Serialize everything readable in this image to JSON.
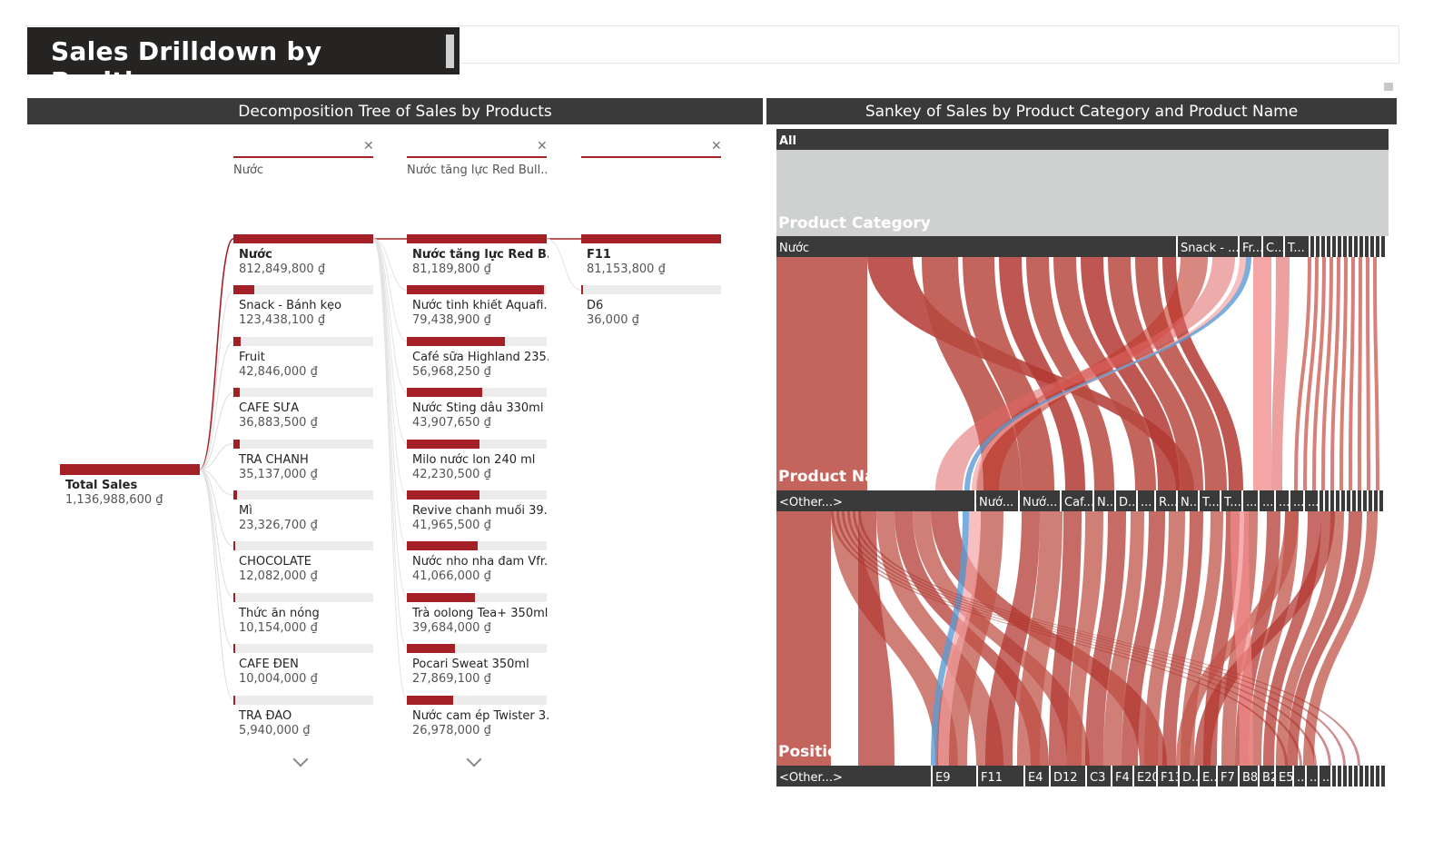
{
  "page": {
    "title": "Sales Drilldown by Positions"
  },
  "decomposition_tree": {
    "header": "Decomposition Tree of Sales by Products",
    "root": {
      "label": "Total Sales",
      "value": "1,136,988,600 ₫"
    },
    "filters": [
      {
        "crumb": "Nước",
        "close": "✕"
      },
      {
        "crumb": "Nước tăng lực Red Bull...",
        "close": "✕"
      },
      {
        "crumb": "",
        "close": "✕"
      }
    ],
    "levels": [
      [
        {
          "label": "Nước",
          "value": "812,849,800 ₫",
          "share": 1.0,
          "selected": true
        },
        {
          "label": "Snack - Bánh kẹo",
          "value": "123,438,100 ₫",
          "share": 0.152
        },
        {
          "label": "Fruit",
          "value": "42,846,000 ₫",
          "share": 0.053
        },
        {
          "label": "CAFE SỮA",
          "value": "36,883,500 ₫",
          "share": 0.045
        },
        {
          "label": "TRÀ CHANH",
          "value": "35,137,000 ₫",
          "share": 0.043
        },
        {
          "label": "Mì",
          "value": "23,326,700 ₫",
          "share": 0.029
        },
        {
          "label": "CHOCOLATE",
          "value": "12,082,000 ₫",
          "share": 0.015
        },
        {
          "label": "Thức ăn nóng",
          "value": "10,154,000 ₫",
          "share": 0.012
        },
        {
          "label": "CAFE ĐEN",
          "value": "10,004,000 ₫",
          "share": 0.012
        },
        {
          "label": "TRÀ ĐÀO",
          "value": "5,940,000 ₫",
          "share": 0.007
        }
      ],
      [
        {
          "label": "Nước tăng lực Red B...",
          "value": "81,189,800 ₫",
          "share": 1.0,
          "selected": true
        },
        {
          "label": "Nước tinh khiết Aquafi...",
          "value": "79,438,900 ₫",
          "share": 0.978
        },
        {
          "label": "Café sữa Highland 235...",
          "value": "56,968,250 ₫",
          "share": 0.702
        },
        {
          "label": "Nước Sting dâu 330ml",
          "value": "43,907,650 ₫",
          "share": 0.541
        },
        {
          "label": "Milo nước lon 240 ml",
          "value": "42,230,500 ₫",
          "share": 0.52
        },
        {
          "label": "Revive chanh muối 39...",
          "value": "41,965,500 ₫",
          "share": 0.517
        },
        {
          "label": "Nước nho nha đam Vfr...",
          "value": "41,066,000 ₫",
          "share": 0.506
        },
        {
          "label": "Trà oolong Tea+ 350ml",
          "value": "39,684,000 ₫",
          "share": 0.489
        },
        {
          "label": "Pocari Sweat 350ml",
          "value": "27,869,100 ₫",
          "share": 0.343
        },
        {
          "label": "Nước cam ép Twister 3...",
          "value": "26,978,000 ₫",
          "share": 0.332
        }
      ],
      [
        {
          "label": "F11",
          "value": "81,153,800 ₫",
          "share": 1.0,
          "selected": true
        },
        {
          "label": "D6",
          "value": "36,000 ₫",
          "share": 0.0004
        }
      ]
    ]
  },
  "sankey": {
    "header": "Sankey of Sales by Product Category and Product Name",
    "stages": [
      "Product Category",
      "Product Name",
      "Position"
    ],
    "all_label": "All",
    "category_nodes": [
      "Nước",
      "Snack - ...",
      "Fr...",
      "C...",
      "T..."
    ],
    "name_nodes": [
      "<Other...>",
      "Nướ...",
      "Nướ...",
      "Caf...",
      "N...",
      "D...",
      "...",
      "R...",
      "N...",
      "T...",
      "T...",
      "...",
      "...",
      "...",
      "...",
      "..."
    ],
    "position_nodes": [
      "<Other...>",
      "E9",
      "F11",
      "E4",
      "D12",
      "C3",
      "F4",
      "E20",
      "F13",
      "D...",
      "E...",
      "F7",
      "B8",
      "B2",
      "E5",
      "...",
      "...",
      "..."
    ]
  },
  "colors": {
    "accent": "#a32027",
    "header_bg": "#3a3a3a",
    "title_bg": "#252423",
    "sankey_band": "#c0392b",
    "sankey_highlight": "#5b9bd5",
    "sankey_grey": "#cfd0d0"
  },
  "chart_data": [
    {
      "type": "decomposition-tree",
      "title": "Decomposition Tree of Sales by Products",
      "root": {
        "name": "Total Sales",
        "value": 1136988600
      },
      "levels": [
        {
          "categories": [
            "Nước",
            "Snack - Bánh kẹo",
            "Fruit",
            "CAFE SỮA",
            "TRÀ CHANH",
            "Mì",
            "CHOCOLATE",
            "Thức ăn nóng",
            "CAFE ĐEN",
            "TRÀ ĐÀO"
          ],
          "values": [
            812849800,
            123438100,
            42846000,
            36883500,
            35137000,
            23326700,
            12082000,
            10154000,
            10004000,
            5940000
          ]
        },
        {
          "categories": [
            "Nước tăng lực Red B...",
            "Nước tinh khiết Aquafi...",
            "Café sữa Highland 235...",
            "Nước Sting dâu 330ml",
            "Milo nước lon 240 ml",
            "Revive chanh muối 39...",
            "Nước nho nha đam Vfr...",
            "Trà oolong Tea+ 350ml",
            "Pocari Sweat 350ml",
            "Nước cam ép Twister 3..."
          ],
          "values": [
            81189800,
            79438900,
            56968250,
            43907650,
            42230500,
            41965500,
            41066000,
            39684000,
            27869100,
            26978000
          ]
        },
        {
          "categories": [
            "F11",
            "D6"
          ],
          "values": [
            81153800,
            36000
          ]
        }
      ]
    },
    {
      "type": "sankey",
      "title": "Sankey of Sales by Product Category and Product Name",
      "stages": [
        "Product Category",
        "Product Name",
        "Position"
      ]
    }
  ]
}
